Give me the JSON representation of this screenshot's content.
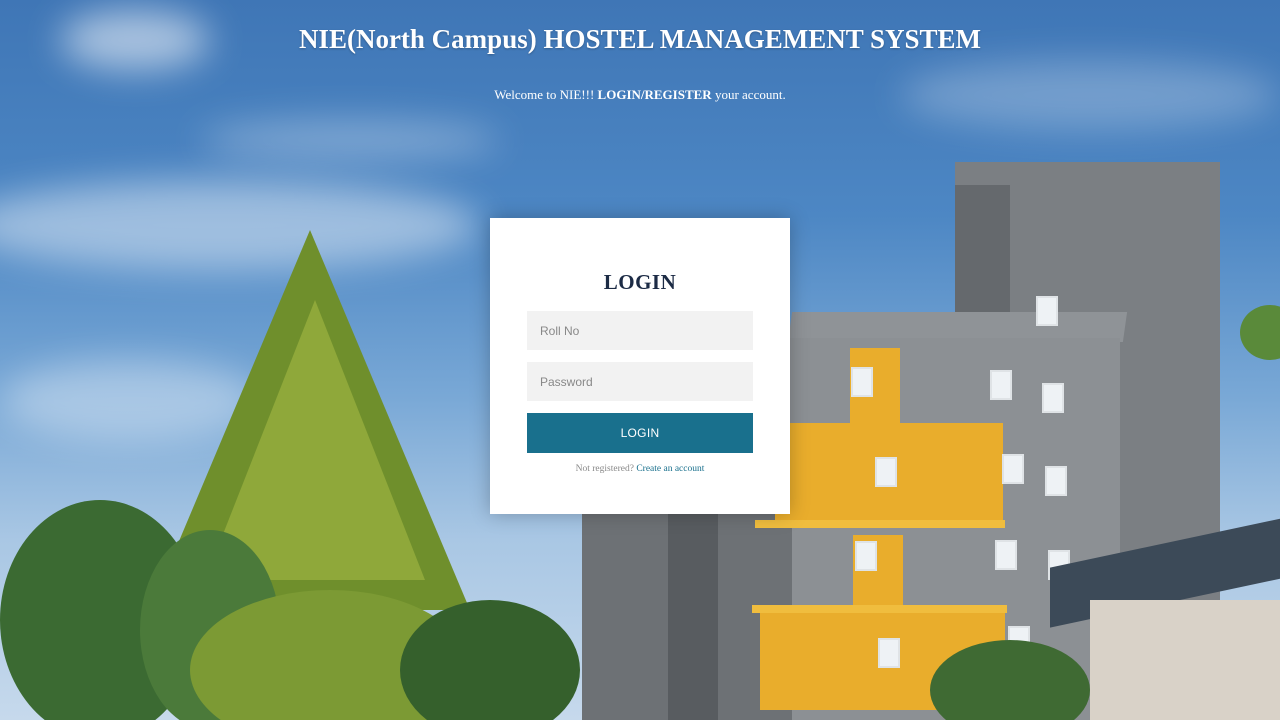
{
  "header": {
    "title": "NIE(North Campus) HOSTEL MANAGEMENT SYSTEM",
    "welcome_prefix": "Welcome to NIE!!!",
    "welcome_bold": "LOGIN/REGISTER",
    "welcome_suffix": "your account."
  },
  "login_form": {
    "heading": "LOGIN",
    "rollno_placeholder": "Roll No",
    "rollno_value": "",
    "password_placeholder": "Password",
    "password_value": "",
    "submit_label": "LOGIN",
    "register_prompt": "Not registered?",
    "register_link": "Create an account"
  },
  "colors": {
    "button": "#19708d",
    "heading": "#1c2b45",
    "link": "#19708d"
  }
}
